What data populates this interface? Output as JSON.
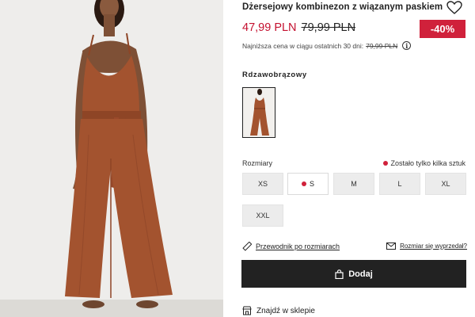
{
  "product": {
    "title": "Dżersejowy kombinezon z wiązanym paskiem",
    "price_current": "47,99 PLN",
    "price_old": "79,99 PLN",
    "discount": "-40%",
    "lowest_price_text": "Najniższa cena w ciągu ostatnich 30 dni:",
    "lowest_price_value": "79,99 PLN"
  },
  "color": {
    "label": "Rdzawobrązowy"
  },
  "sizes": {
    "label": "Rozmiary",
    "stock_note": "Zostało tylko kilka sztuk",
    "options": [
      "XS",
      "S",
      "M",
      "L",
      "XL",
      "XXL"
    ],
    "selected": "S"
  },
  "links": {
    "size_guide": "Przewodnik po rozmiarach",
    "sold_out": "Rozmiar się wyprzedał?"
  },
  "cart": {
    "add_label": "Dodaj"
  },
  "store": {
    "find_label": "Znajdź w sklepie"
  },
  "colors": {
    "accent": "#d0213b",
    "price_sale": "#c4102f",
    "button_dark": "#222222",
    "product_rust": "#a3532f"
  },
  "icons": {
    "favorite": "heart-icon",
    "info": "info-icon",
    "ruler": "ruler-icon",
    "mail": "mail-icon",
    "bag": "bag-icon",
    "store": "store-icon"
  }
}
